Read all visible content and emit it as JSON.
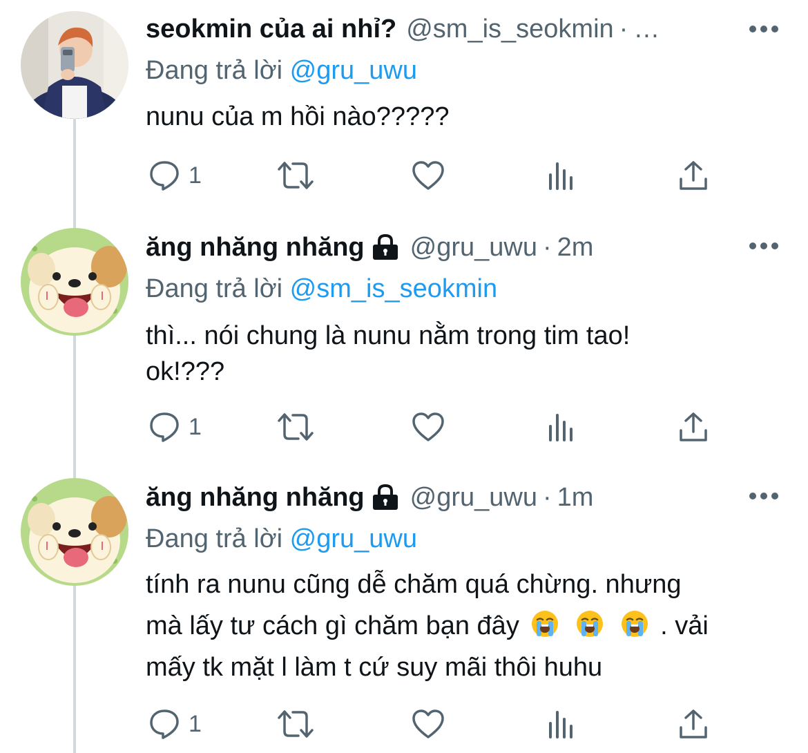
{
  "tweets": [
    {
      "name": "seokmin của ai nhỉ?",
      "handle": "@sm_is_seokmin",
      "sep": "·",
      "time": "…",
      "reply_prefix": "Đang trả lời",
      "reply_mention": "@gru_uwu",
      "text": "nunu của m hồi nào?????",
      "reply_count": "1",
      "avatar": "selfie-photo"
    },
    {
      "name": "ăng nhăng nhăng",
      "handle": "@gru_uwu",
      "sep": "·",
      "time": "2m",
      "reply_prefix": "Đang trả lời",
      "reply_mention": "@sm_is_seokmin",
      "text_line1": "thì... nói chung là nunu nằm trong tim tao!",
      "text_line2": "ok!???",
      "reply_count": "1",
      "avatar": "cartoon-dog",
      "locked": true
    },
    {
      "name": "ăng nhăng nhăng",
      "handle": "@gru_uwu",
      "sep": "·",
      "time": "1m",
      "reply_prefix": "Đang trả lời",
      "reply_mention": "@gru_uwu",
      "text_line1": "tính ra nunu cũng dễ chăm quá chừng. nhưng",
      "text_line2_a": "mà lấy tư cách gì chăm bạn đây",
      "text_line2_b": ". vải",
      "text_line3": "mấy tk mặt l làm t cứ suy mãi thôi huhu",
      "emojis": [
        "loudly-crying-face",
        "loudly-crying-face",
        "loudly-crying-face"
      ],
      "reply_count": "1",
      "avatar": "cartoon-dog",
      "locked": true
    }
  ],
  "icons": {
    "reply": "reply-icon",
    "retweet": "retweet-icon",
    "like": "heart-icon",
    "analytics": "analytics-icon",
    "share": "share-icon",
    "more": "more-icon",
    "lock": "lock-icon"
  },
  "colors": {
    "link": "#1d9bf0",
    "muted": "#536471",
    "text": "#0f1419",
    "thread_line": "#cfd9de"
  }
}
